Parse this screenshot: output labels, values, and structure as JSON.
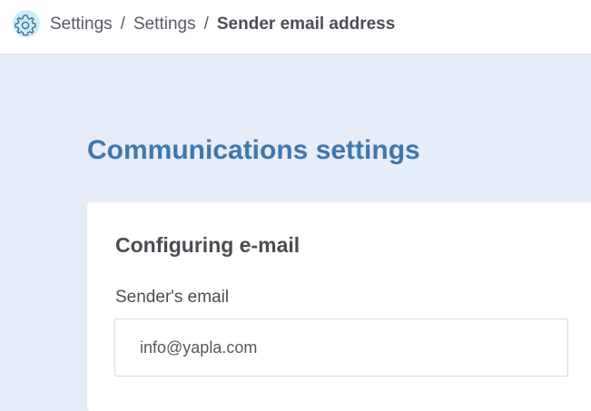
{
  "breadcrumb": {
    "items": [
      "Settings",
      "Settings"
    ],
    "separator": "/",
    "current": "Sender email address"
  },
  "page": {
    "title": "Communications settings"
  },
  "card": {
    "title": "Configuring e-mail",
    "sender_email": {
      "label": "Sender's email",
      "value": "info@yapla.com"
    }
  },
  "icons": {
    "breadcrumb_icon": "gear-icon"
  },
  "colors": {
    "accent": "#3f78ad",
    "page_background": "#e6ecf8",
    "icon_background": "#c9eefa"
  }
}
